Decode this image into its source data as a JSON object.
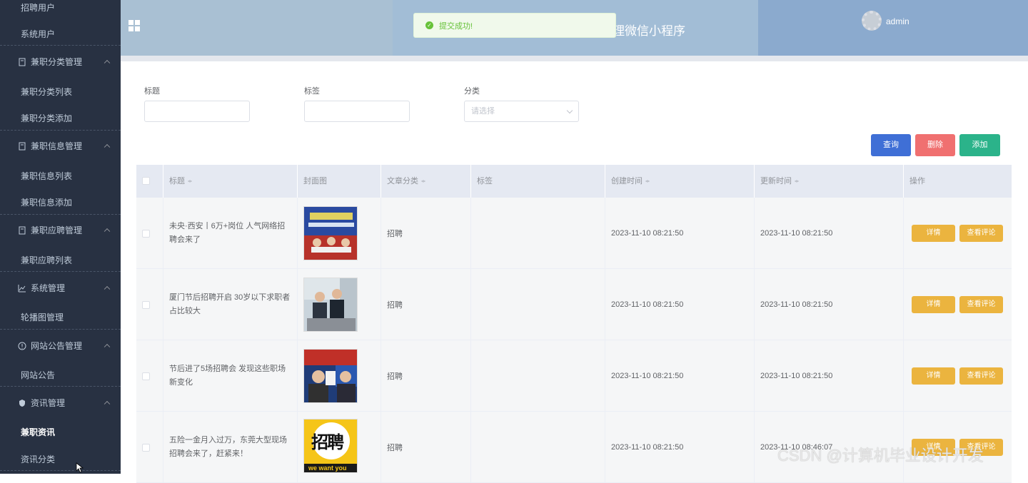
{
  "sidebar": {
    "top_item": "招聘用户",
    "items": [
      {
        "label": "系统用户",
        "type": "sub"
      },
      {
        "label": "兼职分类管理",
        "type": "group",
        "icon": "document-icon"
      },
      {
        "label": "兼职分类列表",
        "type": "sub"
      },
      {
        "label": "兼职分类添加",
        "type": "sub"
      },
      {
        "label": "兼职信息管理",
        "type": "group",
        "icon": "document-icon"
      },
      {
        "label": "兼职信息列表",
        "type": "sub"
      },
      {
        "label": "兼职信息添加",
        "type": "sub"
      },
      {
        "label": "兼职应聘管理",
        "type": "group",
        "icon": "document-icon"
      },
      {
        "label": "兼职应聘列表",
        "type": "sub"
      },
      {
        "label": "系统管理",
        "type": "group",
        "icon": "chart-icon"
      },
      {
        "label": "轮播图管理",
        "type": "sub"
      },
      {
        "label": "网站公告管理",
        "type": "group",
        "icon": "info-icon"
      },
      {
        "label": "网站公告",
        "type": "sub"
      },
      {
        "label": "资讯管理",
        "type": "group",
        "icon": "shield-icon"
      },
      {
        "label": "兼职资讯",
        "type": "sub",
        "active": true
      },
      {
        "label": "资讯分类",
        "type": "sub"
      }
    ]
  },
  "header": {
    "title": "理微信小程序",
    "username": "admin"
  },
  "toast": {
    "message": "提交成功!"
  },
  "filters": {
    "title_label": "标题",
    "tag_label": "标签",
    "category_label": "分类",
    "category_placeholder": "请选择"
  },
  "actions": {
    "query": "查询",
    "delete": "删除",
    "add": "添加"
  },
  "colors": {
    "query": "#3f6fd6",
    "delete": "#f07070",
    "add": "#2bb38a",
    "row_action": "#ebb43f"
  },
  "table": {
    "headers": {
      "title": "标题",
      "cover": "封面图",
      "category": "文章分类",
      "tag": "标签",
      "created": "创建时间",
      "updated": "更新时间",
      "ops": "操作"
    },
    "rows": [
      {
        "title": "未央·西安丨6万+岗位 人气网络招聘会来了",
        "category": "招聘",
        "tag": "",
        "created": "2023-11-10 08:21:50",
        "updated": "2023-11-10 08:21:50",
        "detail": "详情",
        "comments": "查看评论"
      },
      {
        "title": "厦门节后招聘开启 30岁以下求职者占比较大",
        "category": "招聘",
        "tag": "",
        "created": "2023-11-10 08:21:50",
        "updated": "2023-11-10 08:21:50",
        "detail": "详情",
        "comments": "查看评论"
      },
      {
        "title": "节后进了5场招聘会 发现这些职场新变化",
        "category": "招聘",
        "tag": "",
        "created": "2023-11-10 08:21:50",
        "updated": "2023-11-10 08:21:50",
        "detail": "详情",
        "comments": "查看评论"
      },
      {
        "title": "五险一金月入过万，东莞大型现场招聘会来了，赶紧来！",
        "category": "招聘",
        "tag": "",
        "created": "2023-11-10 08:21:50",
        "updated": "2023-11-10 08:46:07",
        "detail": "详情",
        "comments": "查看评论"
      }
    ]
  },
  "poster_text": {
    "big": "招聘",
    "small": "we want you"
  },
  "watermark": "CSDN @计算机毕业设计开发"
}
